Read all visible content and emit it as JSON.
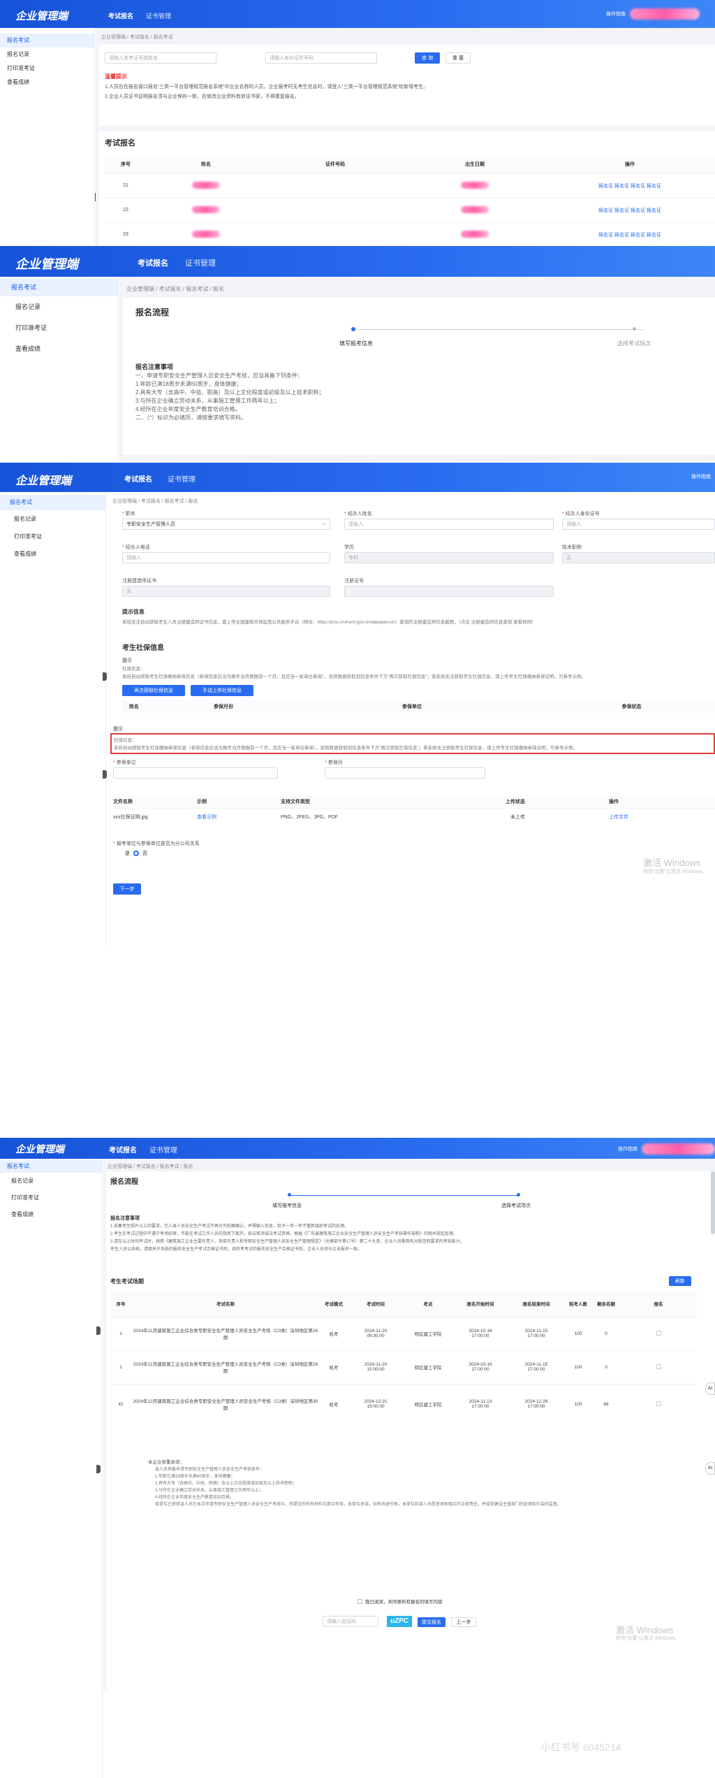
{
  "app": {
    "brand": "企业管理端",
    "nav": [
      "考试报名",
      "证书管理"
    ],
    "user_link": "操作指南",
    "user_link_alt": "操作指南"
  },
  "sidebar": [
    "报名考试",
    "报名记录",
    "打印准考证",
    "查看成绩"
  ],
  "p1": {
    "crumbs": "企业管理端 / 考试报名 / 报名考试",
    "search_placeholder": "请输入准考证号或姓名",
    "search2_placeholder": "请输入身份证件号码",
    "query": "查 询",
    "reset": "重 置",
    "notice_title": "温馨提示",
    "notice1": "1.人员应在报名窗口报名“三类一平台管理规范报名系统”中企业名称的人员，企业报考时无考生信息时，请登入“三类一平台管理规范系统”给新增考生。",
    "notice2": "2.企业人员证书证明报名须与企业保存一致，在修改企业资料有效证书家，不得重复报名。",
    "section": "考试报名",
    "headers": [
      "序号",
      "姓名",
      "证件号码",
      "出生日期",
      "操作"
    ],
    "rows": [
      {
        "no": "21",
        "ops": [
          "报名证",
          "报名证",
          "报名证",
          "报名证"
        ]
      },
      {
        "no": "22",
        "ops": [
          "报名证",
          "报名证",
          "报名证",
          "报名证"
        ]
      },
      {
        "no": "23",
        "ops": [
          "报名证",
          "报名证",
          "报名证",
          "报名证"
        ]
      }
    ]
  },
  "p2": {
    "crumbs": "企业管理端 / 考试报名 / 报名考试 / 报名",
    "title": "报名流程",
    "steps": [
      "填写报考信息",
      "选择考试场次"
    ],
    "notes_title": "报名注意事项",
    "notes": [
      "一、申请专职安全生产管理人员安全生产考核，应当具备下列条件：",
      "1.年龄已满18周岁未满60周岁，身体健康；",
      "2.具有大专（含高中、中技、职高）及以上文化程度或初级及以上技术职称；",
      "3.与所在企业确立劳动关系，从事施工管理工作两年以上；",
      "4.经所在企业年度安全生产教育培训合格。",
      "二、（*）标识为必填项，请按要求填写资料。"
    ]
  },
  "p3": {
    "crumbs": "企业管理端 / 考试报名 / 报名考试 / 报名",
    "f_role": "职务",
    "f_role_val": "专职安全生产管理人员",
    "f_name": "经办人姓名",
    "f_name_ph": "请输入",
    "f_id": "经办人身份证号",
    "f_id_ph": "请输入",
    "f_phone": "经办人电话",
    "f_phone_ph": "请输入",
    "f_edu": "学历",
    "f_edu_val": "专科",
    "f_title": "技术职称",
    "f_title_val": "无",
    "f_reg": "注册建造师证书",
    "f_reg_val": "无",
    "f_cert": "注册证号",
    "tip_title": "提示信息",
    "tip_text": "系统无法自动获取考生人员注册建造师证书信息，需上传全国建筑市场监管公共服务平台（网址：https://jzsc.mohurd.gov.cn/data/person）查询的注册建造师信息截图。（点击 注册建造师信息查询 查看样例）",
    "social_title": "考生社保信息",
    "s_tip_title": "提示",
    "s_tip_label": "社保信息：",
    "s_tip_text": "系统自动获取考生社保缴纳参保信息（参保信息应当为报考当月倒推前一个月，且应当一家单位参保），如将数据获取到信息条件下方“再次获取社保信息”；若系统无法获取考生社保信息，请上传考生社保缴纳参保证明，可参考示例。",
    "btn_again": "再次获取社保信息",
    "btn_upload": "手动上传社保信息",
    "s_headers": [
      "姓名",
      "参保月份",
      "参保单位",
      "参保状态"
    ],
    "r_tip_title": "提示",
    "r_tip_label": "社保信息：",
    "r_tip_text": "系统自动获取考生社保缴纳参保信息（参保信息应当为报考当月倒推前一个月，且应当一家单位参保），如将数据获取到信息条件下方“再次获取社保信息”；若系统无法获取考生社保信息，请上传考生社保缴纳参保证明，可参考示例。",
    "f_unit": "参保单位",
    "f_month": "参保月",
    "u_headers": [
      "文件名称",
      "示例",
      "支持文件类型",
      "上传状态",
      "操作"
    ],
    "u_file": "xxx社保证明.jpg",
    "u_sample": "查看示例",
    "u_types": "PNG、JPEG、JPG、PDF",
    "u_status": "未上传",
    "u_op": "上传文件",
    "q_label": "报考单位与参保单位是否为分公司关系",
    "q_yes": "是",
    "q_no": "否",
    "next": "下一步",
    "wm1": "激活 Windows",
    "wm2": "转到“设置”以激活 Windows。"
  },
  "p4": {
    "crumbs": "企业管理端 / 考试报名 / 报名考试 / 报名",
    "title": "报名流程",
    "steps": [
      "填写报考信息",
      "选择考试场次"
    ],
    "notes_title": "报名注意事项",
    "notes": [
      "1.采集考生照片以上的要求，已入录人员安全生产考试不再分为前面确认，并需输入信息，给予一年一年不重新组织考试的处理。",
      "2.考生在考试过程中不遵守考场纪律，不能在考试工作人员的指挥下离开，依法取消该次考试资格，根据《广东省建筑施工企业安全生产管理人员安全生产考核操作规程》的相关规定处理。",
      "3.请在以上时间考试时，按照《建筑施工企业主要负责人、项目负责人和专职安全生产管理人员安全生产管理规定》（住建部令第17号）第二十九条，企业人员需具有对规范和要求的考核能力。",
      "考生人员以系统，请相关于系统的报名安全生产考试合格证书后，如所考考试的报名安全生产合格证书后，企业人员须与企业报名一致。"
    ],
    "exam_title": "考生考试场期",
    "refresh": "刷新",
    "e_headers": [
      "序号",
      "考试名称",
      "考试模式",
      "考试时间",
      "考点",
      "报名开始时间",
      "报名结束时间",
      "招考人数",
      "剩余名额",
      "报名"
    ],
    "exams": [
      {
        "no": "1",
        "name": "2024年11月建筑施工企业综合类专职安全生产管理人员安全生产考核（C3类）深圳地区第26期",
        "mode": "机考",
        "time": "2024-11-20\n09:30:00",
        "site": "特区建工学院",
        "start": "2024-10-16\n17:00:00",
        "end": "2024-11-15\n17:00:00",
        "quota": "100",
        "remain": "0"
      },
      {
        "no": "2",
        "name": "2024年11月建筑施工企业综合类专职安全生产管理人员安全生产考核（C3类）深圳地区第28期",
        "mode": "机考",
        "time": "2024-11-20\n15:00:00",
        "site": "特区建工学院",
        "start": "2024-10-16\n17:00:00",
        "end": "2024-11-15\n17:00:00",
        "quota": "100",
        "remain": "0"
      },
      {
        "no": "42",
        "name": "2024年12月建筑施工企业综合类专职安全生产管理人员安全生产考核（C3类）深圳地区第30期",
        "mode": "机考",
        "time": "2024-12-31\n15:00:00",
        "site": "特区建工学院",
        "start": "2024-11-13\n17:00:00",
        "end": "2024-12-28\n17:00:00",
        "quota": "100",
        "remain": "86"
      }
    ],
    "promise_title": "本企业郑重承诺：",
    "promise": [
      "该人员具备申请专职安全生产管理人员安全生产考核条件：",
      "1.年龄已满18周岁未满60周岁，身体健康；",
      "2.具有大专（含高中、中技、职高）及以上文化程度或初级及以上技术职称；",
      "3.与所在企业确立劳动关系，从事施工管理工作两年以上；",
      "4.经所在企业年度安全生产教育培训合格。",
      "我单位已审核该人员在本次申请专职安全生产管理人员安全生产考核中，所提交的所有材料均真实有效，本单位承诺，如有弄虚作假，本单位和该人员愿意承担相应的法律责任，并接受建设主管部门的处理及社会的监督。"
    ],
    "agree": "我已阅读，并同意所有报名的填写内容",
    "code_ph": "请输入验证码",
    "captcha": "uZPC",
    "submit": "提交报名",
    "prev": "上一步",
    "wm1": "激活 Windows",
    "wm2": "转到“设置”以激活 Windows。",
    "wm3": "小红书号 6045214"
  },
  "side_icons": [
    "AI",
    "AI"
  ]
}
